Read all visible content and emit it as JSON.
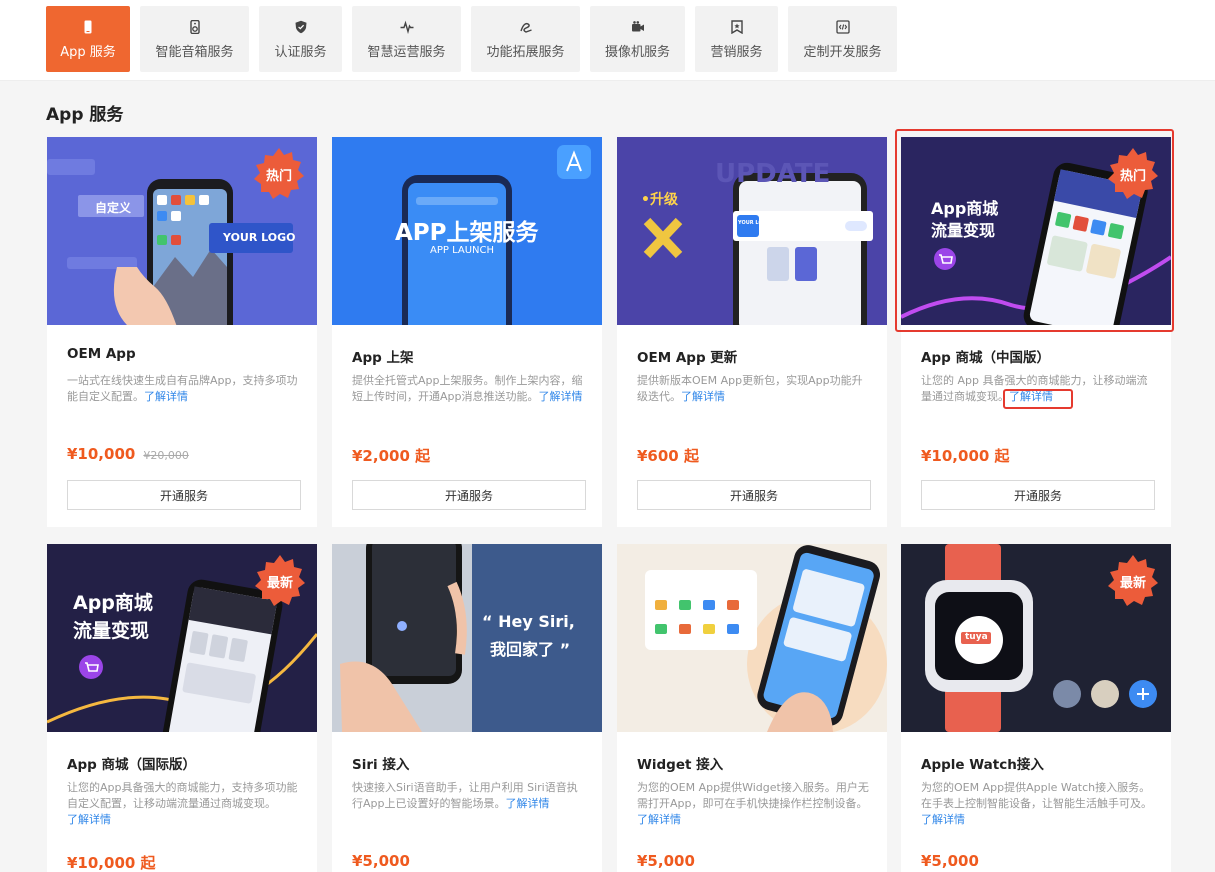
{
  "tabs": [
    {
      "label": "App 服务",
      "icon": "phone-icon",
      "active": true
    },
    {
      "label": "智能音箱服务",
      "icon": "speaker-icon",
      "active": false
    },
    {
      "label": "认证服务",
      "icon": "shield-icon",
      "active": false
    },
    {
      "label": "智慧运营服务",
      "icon": "pulse-icon",
      "active": false
    },
    {
      "label": "功能拓展服务",
      "icon": "extend-icon",
      "active": false
    },
    {
      "label": "摄像机服务",
      "icon": "camera-icon",
      "active": false
    },
    {
      "label": "营销服务",
      "icon": "bookmark-icon",
      "active": false
    },
    {
      "label": "定制开发服务",
      "icon": "code-icon",
      "active": false
    }
  ],
  "section": {
    "title": "App 服务"
  },
  "button_label": "开通服务",
  "link_label": "了解详情",
  "cards": [
    {
      "title": "OEM App",
      "desc": "一站式在线快速生成自有品牌App，支持多项功能自定义配置。",
      "price": "¥10,000",
      "old_price": "¥20,000",
      "badge": "热门",
      "banner": {
        "texts": [
          "自定义",
          "YOUR LOGO"
        ],
        "bg": "#5b67d6"
      }
    },
    {
      "title": "App 上架",
      "desc": "提供全托管式App上架服务。制作上架内容，缩短上传时间，开通App消息推送功能。",
      "price": "¥2,000 起",
      "old_price": "",
      "banner": {
        "texts": [
          "APP上架服务",
          "APP LAUNCH"
        ],
        "bg": "#2f7bf0"
      }
    },
    {
      "title": "OEM App 更新",
      "desc": "提供新版本OEM App更新包，实现App功能升级迭代。",
      "price": "¥600 起",
      "old_price": "",
      "banner": {
        "texts": [
          "•升级",
          "UPDATE",
          "YOUR LOGO"
        ],
        "bg": "#4b44a8"
      }
    },
    {
      "title": "App 商城（中国版）",
      "desc": "让您的 App 具备强大的商城能力，让移动端流量通过商城变现。",
      "price": "¥10,000 起",
      "old_price": "",
      "badge": "热门",
      "banner": {
        "texts": [
          "App商城",
          "流量变现"
        ],
        "bg": "#2a2560"
      }
    },
    {
      "title": "App 商城（国际版）",
      "desc": "让您的App具备强大的商城能力，支持多项功能自定义配置，让移动端流量通过商城变现。",
      "price": "¥10,000 起",
      "old_price": "",
      "badge": "最新",
      "banner": {
        "texts": [
          "App商城",
          "流量变现"
        ],
        "bg": "#232046"
      }
    },
    {
      "title": "Siri 接入",
      "desc": "快速接入Siri语音助手，让用户利用 Siri语音执行App上已设置好的智能场景。",
      "price": "¥5,000",
      "old_price": "",
      "banner": {
        "texts": [
          "“ Hey Siri,",
          "我回家了 ”"
        ],
        "bg": "#3d5a8c"
      }
    },
    {
      "title": "Widget 接入",
      "desc": "为您的OEM App提供Widget接入服务。用户无需打开App，即可在手机快捷操作栏控制设备。",
      "price": "¥5,000",
      "old_price": "",
      "banner": {
        "texts": [],
        "bg": "#f3ede4"
      }
    },
    {
      "title": "Apple Watch接入",
      "desc": "为您的OEM App提供Apple Watch接入服务。在手表上控制智能设备，让智能生活触手可及。",
      "price": "¥5,000",
      "old_price": "",
      "badge": "最新",
      "banner": {
        "texts": [
          "tuya"
        ],
        "bg": "#1f2233"
      }
    }
  ]
}
